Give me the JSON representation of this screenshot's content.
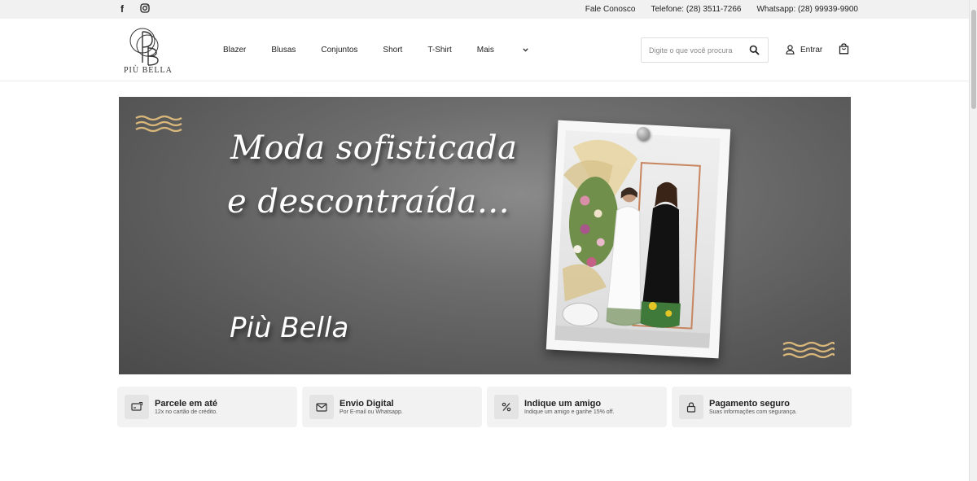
{
  "topbar": {
    "social": [
      {
        "name": "facebook-icon",
        "glyph": "f"
      },
      {
        "name": "instagram-icon",
        "glyph": "◎"
      }
    ],
    "contact_label": "Fale Conosco",
    "phone": "Telefone: (28) 3511-7266",
    "whatsapp": "Whatsapp: (28) 99939-9900"
  },
  "header": {
    "logo_text": "PIÙ BELLA",
    "nav": [
      "Blazer",
      "Blusas",
      "Conjuntos",
      "Short",
      "T-Shirt",
      "Mais"
    ],
    "search_placeholder": "Digite o que você procura",
    "login_label": "Entrar"
  },
  "banner": {
    "headline_1": "Moda sofisticada",
    "headline_2": "e descontraída…",
    "brand": "Più Bella",
    "accent_color": "#d9b77a"
  },
  "features": [
    {
      "icon": "credit-card-icon",
      "title": "Parcele em até",
      "subtitle": "12x no cartão de crédito."
    },
    {
      "icon": "envelope-icon",
      "title": "Envio Digital",
      "subtitle": "Por E-mail ou Whatsapp."
    },
    {
      "icon": "percent-icon",
      "title": "Indique um amigo",
      "subtitle": "Indique um amigo e ganhe 15% off."
    },
    {
      "icon": "lock-icon",
      "title": "Pagamento seguro",
      "subtitle": "Suas informações com segurança."
    }
  ]
}
